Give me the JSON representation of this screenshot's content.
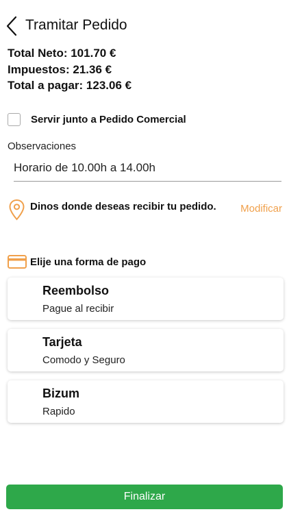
{
  "header": {
    "title": "Tramitar Pedido",
    "back_icon": "chevron-left-icon"
  },
  "totals": {
    "neto": "Total Neto: 101.70 €",
    "impuestos": "Impuestos: 21.36 €",
    "total": "Total a pagar: 123.06 €"
  },
  "serve_with_order": {
    "label": "Servir junto a Pedido Comercial",
    "checked": false
  },
  "observations": {
    "label": "Observaciones",
    "value": "Horario de 10.00h a 14.00h"
  },
  "address": {
    "prompt": "Dinos donde deseas recibir tu pedido.",
    "modify_label": "Modificar",
    "icon": "location-pin-icon"
  },
  "payment": {
    "heading": "Elije una forma de pago",
    "icon": "credit-card-icon",
    "options": [
      {
        "title": "Reembolso",
        "subtitle": "Pague al recibir"
      },
      {
        "title": "Tarjeta",
        "subtitle": "Comodo y Seguro"
      },
      {
        "title": "Bizum",
        "subtitle": "Rapido"
      }
    ]
  },
  "footer": {
    "finalize_label": "Finalizar"
  },
  "colors": {
    "accent": "#f0a04b",
    "primary_button": "#2ea84a"
  }
}
